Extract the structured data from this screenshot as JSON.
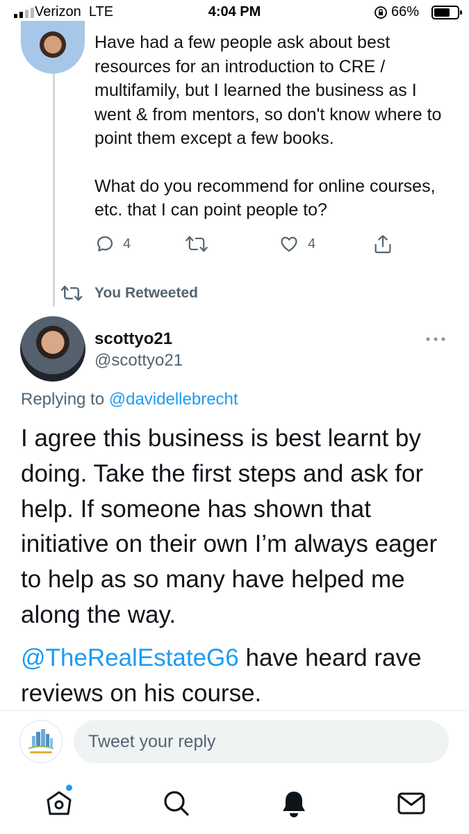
{
  "status_bar": {
    "carrier": "Verizon",
    "network": "LTE",
    "time": "4:04 PM",
    "battery": "66%",
    "battery_level": 0.66,
    "signal_bars": 2
  },
  "parent_tweet": {
    "paragraphs": [
      "Have had a few people ask about best resources for an introduction to CRE / multifamily, but I learned the business as I went & from mentors, so don't know where to point them except a few books.",
      "What do you recommend for online courses, etc. that I can point people to?"
    ],
    "actions": {
      "reply_count": "4",
      "like_count": "4"
    },
    "icons": [
      "reply-icon",
      "retweet-icon",
      "like-icon",
      "share-icon"
    ]
  },
  "retweet_indicator": {
    "label": "You Retweeted"
  },
  "main_tweet": {
    "author_name": "scottyo21",
    "author_handle": "@scottyo21",
    "replying_to_label": "Replying to",
    "replying_to_handle": "@davidellebrecht",
    "paragraph_1": "I agree this business is best learnt by doing. Take the first steps and ask for help. If someone has shown that initiative on their own I’m always eager to help as so many have helped me along the way.",
    "paragraph_2_mention": "@TheRealEstateG6",
    "paragraph_2_text": " have heard rave reviews on his course."
  },
  "reply_bar": {
    "placeholder": "Tweet your reply"
  },
  "bottom_nav": {
    "items": [
      "home-icon",
      "search-icon",
      "notifications-icon",
      "messages-icon"
    ]
  },
  "colors": {
    "accent": "#1d9bf0",
    "text": "#0f1419",
    "muted": "#536471"
  }
}
